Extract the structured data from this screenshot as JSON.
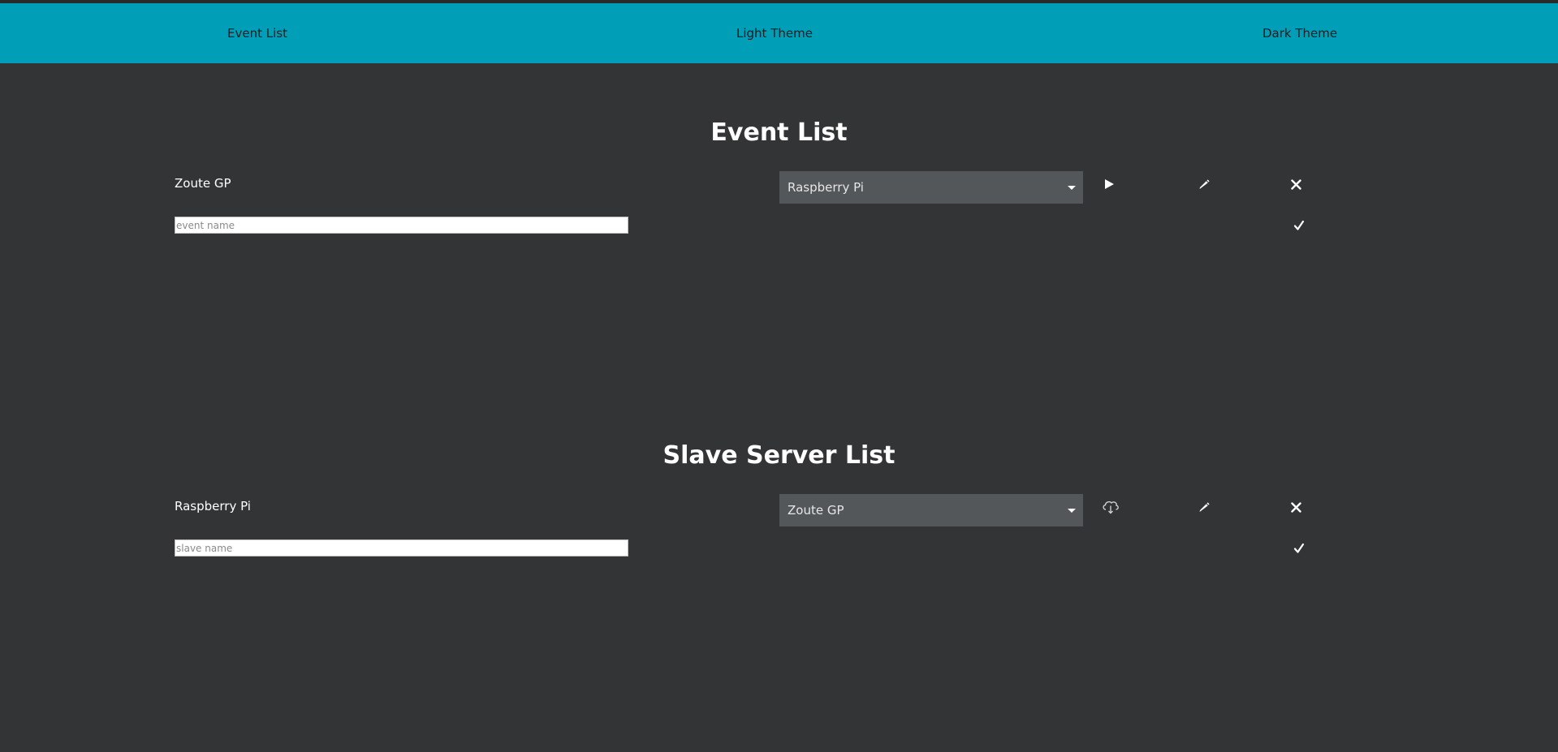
{
  "nav": {
    "event_list": "Event List",
    "light_theme": "Light Theme",
    "dark_theme": "Dark Theme"
  },
  "events": {
    "title": "Event List",
    "rows": [
      {
        "name": "Zoute GP",
        "selected_server": "Raspberry Pi"
      }
    ],
    "new_placeholder": "event name"
  },
  "slaves": {
    "title": "Slave Server List",
    "rows": [
      {
        "name": "Raspberry Pi",
        "selected_event": "Zoute GP"
      }
    ],
    "new_placeholder": "slave name"
  },
  "icons": {
    "play": "play-icon",
    "cloud": "cloud-download-icon",
    "edit": "pencil-icon",
    "delete": "close-icon",
    "confirm": "check-icon"
  },
  "colors": {
    "navbar": "#009fb7",
    "background": "#333436",
    "select_bg": "#53575a"
  }
}
